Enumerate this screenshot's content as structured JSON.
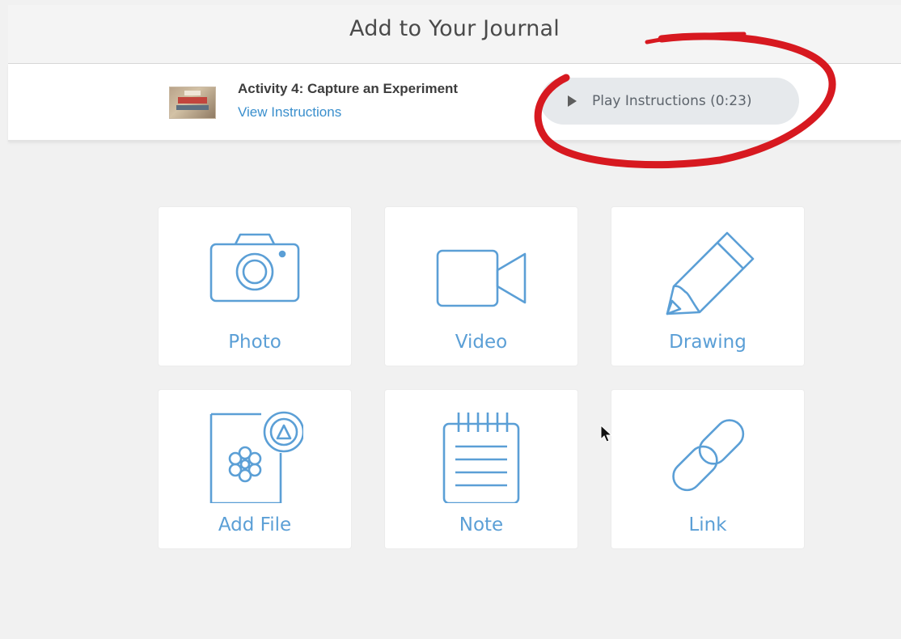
{
  "header": {
    "title": "Add to Your Journal"
  },
  "activity": {
    "title": "Activity 4: Capture an Experiment",
    "view_link": "View Instructions",
    "play_label": "Play Instructions (0:23)"
  },
  "tiles": [
    {
      "label": "Photo",
      "icon": "camera-icon"
    },
    {
      "label": "Video",
      "icon": "video-camera-icon"
    },
    {
      "label": "Drawing",
      "icon": "pencil-icon"
    },
    {
      "label": "Add File",
      "icon": "file-upload-icon"
    },
    {
      "label": "Note",
      "icon": "notepad-icon"
    },
    {
      "label": "Link",
      "icon": "link-icon"
    }
  ],
  "colors": {
    "accent": "#5b9fd6",
    "link": "#3a8fcd",
    "annotation": "#d71920",
    "background": "#f1f1f1"
  }
}
